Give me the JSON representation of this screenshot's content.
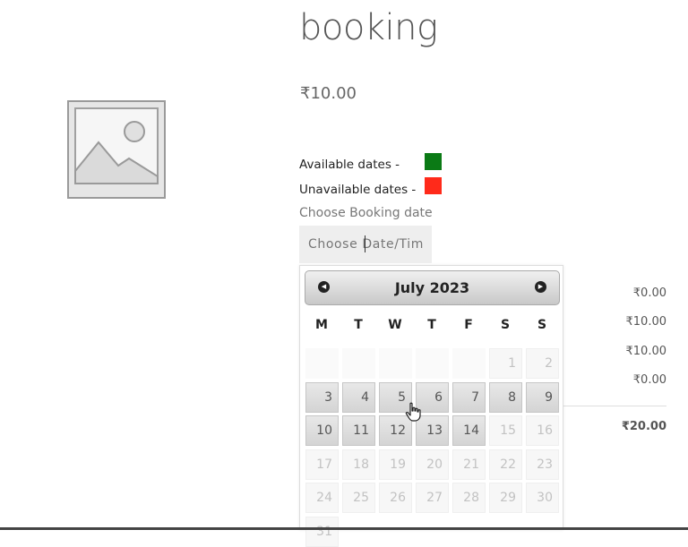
{
  "product": {
    "title": "booking",
    "price": "₹10.00",
    "image_icon": "image-placeholder-icon"
  },
  "legend": {
    "available_label": "Available dates -",
    "available_color": "#0b7a15",
    "unavailable_label": "Unavailable dates -",
    "unavailable_color": "#ff2a1a"
  },
  "booking": {
    "label": "Choose Booking date",
    "input_placeholder": "Choose Date/Time"
  },
  "totals": {
    "rows": [
      "₹0.00",
      "₹10.00",
      "₹10.00",
      "₹0.00"
    ],
    "total": "₹20.00"
  },
  "datepicker": {
    "month_label": "July 2023",
    "prev_icon": "prev-arrow-icon",
    "next_icon": "next-arrow-icon",
    "weekdays": [
      "M",
      "T",
      "W",
      "T",
      "F",
      "S",
      "S"
    ],
    "weeks": [
      [
        null,
        null,
        null,
        null,
        null,
        {
          "d": "1",
          "s": "disabled"
        },
        {
          "d": "2",
          "s": "disabled"
        }
      ],
      [
        {
          "d": "3",
          "s": "active"
        },
        {
          "d": "4",
          "s": "active"
        },
        {
          "d": "5",
          "s": "active"
        },
        {
          "d": "6",
          "s": "active"
        },
        {
          "d": "7",
          "s": "active"
        },
        {
          "d": "8",
          "s": "active"
        },
        {
          "d": "9",
          "s": "active"
        }
      ],
      [
        {
          "d": "10",
          "s": "active"
        },
        {
          "d": "11",
          "s": "active"
        },
        {
          "d": "12",
          "s": "active"
        },
        {
          "d": "13",
          "s": "active"
        },
        {
          "d": "14",
          "s": "active"
        },
        {
          "d": "15",
          "s": "disabled"
        },
        {
          "d": "16",
          "s": "disabled"
        }
      ],
      [
        {
          "d": "17",
          "s": "disabled"
        },
        {
          "d": "18",
          "s": "disabled"
        },
        {
          "d": "19",
          "s": "disabled"
        },
        {
          "d": "20",
          "s": "disabled"
        },
        {
          "d": "21",
          "s": "disabled"
        },
        {
          "d": "22",
          "s": "disabled"
        },
        {
          "d": "23",
          "s": "disabled"
        }
      ],
      [
        {
          "d": "24",
          "s": "disabled"
        },
        {
          "d": "25",
          "s": "disabled"
        },
        {
          "d": "26",
          "s": "disabled"
        },
        {
          "d": "27",
          "s": "disabled"
        },
        {
          "d": "28",
          "s": "disabled"
        },
        {
          "d": "29",
          "s": "disabled"
        },
        {
          "d": "30",
          "s": "disabled"
        }
      ],
      [
        {
          "d": "31",
          "s": "disabled"
        },
        null,
        null,
        null,
        null,
        null,
        null
      ]
    ]
  }
}
